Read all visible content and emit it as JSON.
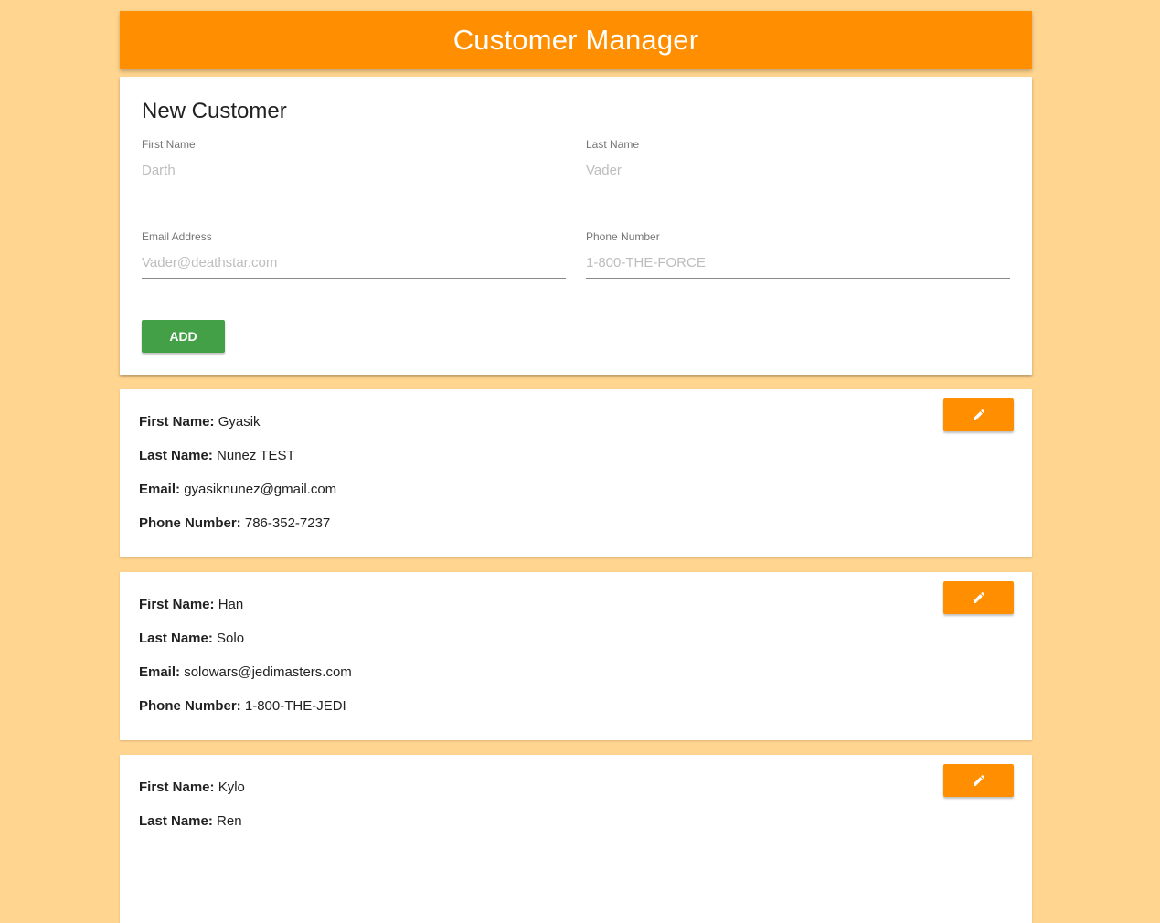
{
  "header": {
    "title": "Customer Manager"
  },
  "form": {
    "title": "New Customer",
    "first_name": {
      "label": "First Name",
      "placeholder": "Darth"
    },
    "last_name": {
      "label": "Last Name",
      "placeholder": "Vader"
    },
    "email": {
      "label": "Email Address",
      "placeholder": "Vader@deathstar.com"
    },
    "phone": {
      "label": "Phone Number",
      "placeholder": "1-800-THE-FORCE"
    },
    "add_label": "ADD"
  },
  "labels": {
    "first_name": "First Name:",
    "last_name": "Last Name:",
    "email": "Email:",
    "phone": "Phone Number:"
  },
  "customers": [
    {
      "first_name": "Gyasik",
      "last_name": "Nunez TEST",
      "email": "gyasiknunez@gmail.com",
      "phone": "786-352-7237",
      "edit_icon": "pencil-icon"
    },
    {
      "first_name": "Han",
      "last_name": "Solo",
      "email": "solowars@jedimasters.com",
      "phone": "1-800-THE-JEDI",
      "edit_icon": "pencil-icon"
    },
    {
      "first_name": "Kylo",
      "last_name": "Ren",
      "edit_icon": "pencil-icon"
    }
  ],
  "colors": {
    "background": "#FFD58F",
    "header": "#FF8F00",
    "add_button": "#43A047",
    "edit_button": "#FF8F00"
  }
}
